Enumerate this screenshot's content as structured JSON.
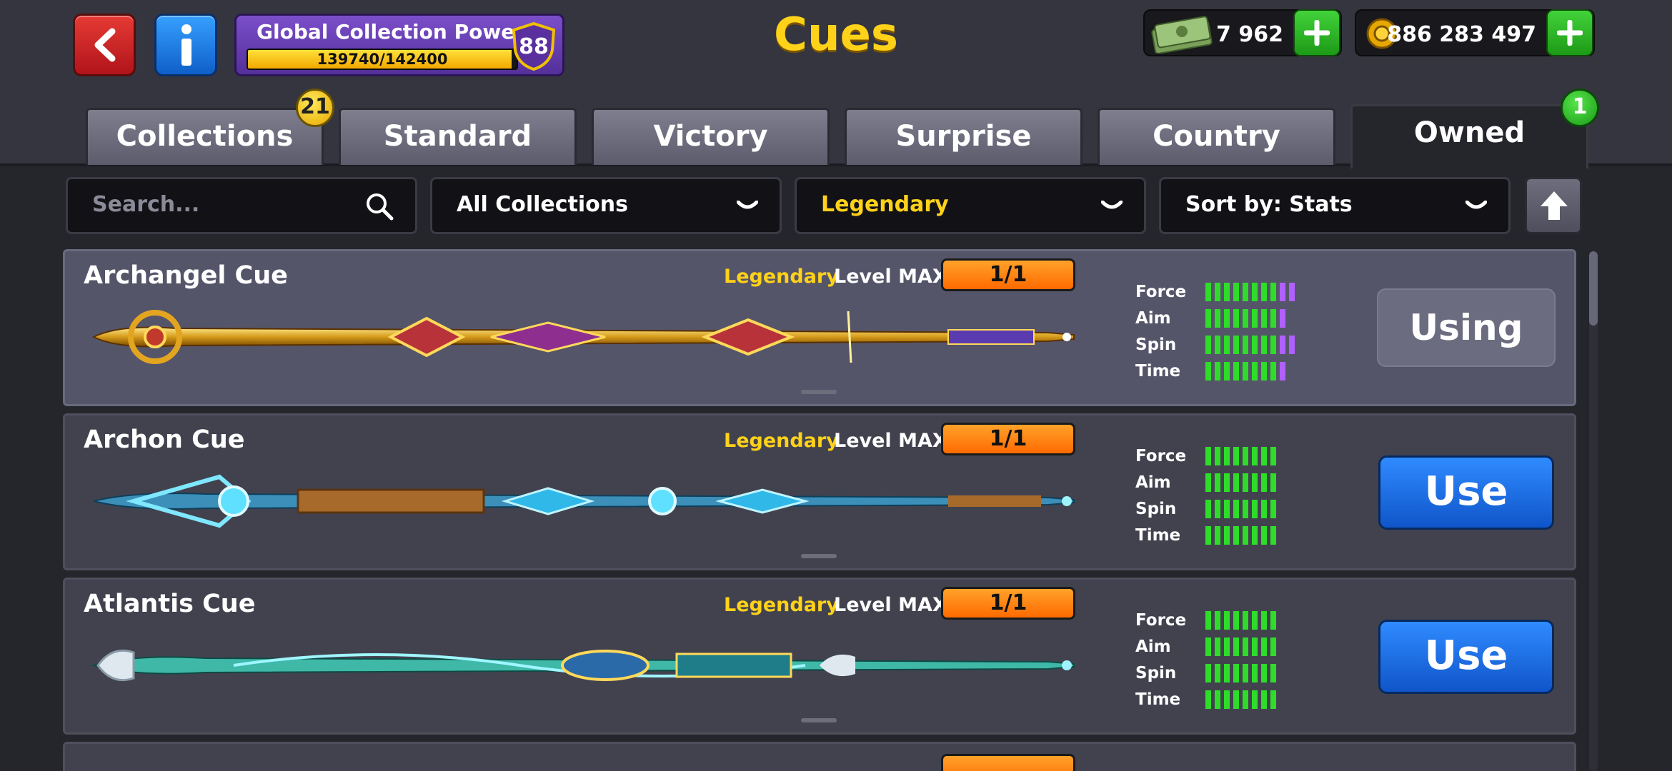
{
  "header": {
    "title": "Cues",
    "collection_power": {
      "label": "Global Collection Power",
      "progress_text": "139740/142400",
      "progress": 0.9813,
      "level": "88"
    },
    "cash": "7 962",
    "coins": "886 283 497"
  },
  "tabs": [
    {
      "label": "Collections",
      "badge": "21"
    },
    {
      "label": "Standard"
    },
    {
      "label": "Victory"
    },
    {
      "label": "Surprise"
    },
    {
      "label": "Country"
    },
    {
      "label": "Owned",
      "badge": "1",
      "active": true
    }
  ],
  "toolbar": {
    "search_placeholder": "Search...",
    "collection_filter": "All Collections",
    "rarity_filter": "Legendary",
    "sort": "Sort by: Stats"
  },
  "stat_labels": [
    "Force",
    "Aim",
    "Spin",
    "Time"
  ],
  "cues": [
    {
      "name": "Archangel Cue",
      "rarity": "Legendary",
      "level": "Level MAX",
      "count": "1/1",
      "action": "Using",
      "stats": {
        "force": 10,
        "aim": 9,
        "spin": 10,
        "time": 9
      }
    },
    {
      "name": "Archon Cue",
      "rarity": "Legendary",
      "level": "Level MAX",
      "count": "1/1",
      "action": "Use",
      "stats": {
        "force": 8,
        "aim": 8,
        "spin": 8,
        "time": 8
      }
    },
    {
      "name": "Atlantis Cue",
      "rarity": "Legendary",
      "level": "Level MAX",
      "count": "1/1",
      "action": "Use",
      "stats": {
        "force": 8,
        "aim": 8,
        "spin": 8,
        "time": 8
      }
    }
  ],
  "colors": {
    "accent": "#ffd21a",
    "stat_green": "#2fdc2a",
    "stat_purple": "#b060ff",
    "use_blue": "#1f6fe6"
  }
}
